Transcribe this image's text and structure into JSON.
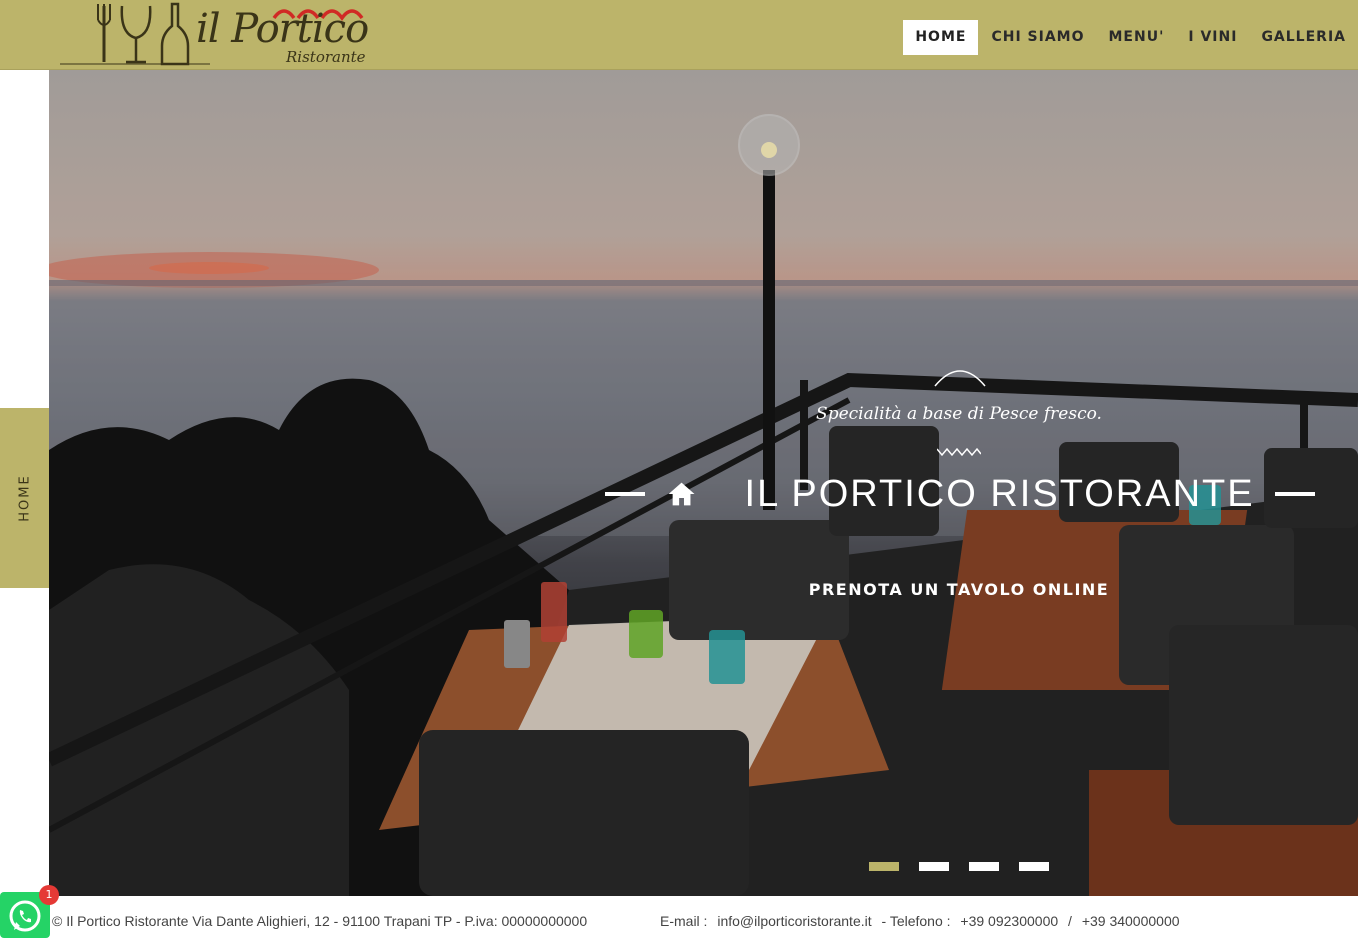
{
  "brand": {
    "logo_name": "il Portico",
    "logo_sub": "Ristorante",
    "accent_color": "#bcb46a"
  },
  "nav": {
    "items": [
      {
        "label": "HOME",
        "active": true
      },
      {
        "label": "CHI SIAMO",
        "active": false
      },
      {
        "label": "MENU'",
        "active": false
      },
      {
        "label": "I VINI",
        "active": false
      },
      {
        "label": "GALLERIA",
        "active": false
      }
    ]
  },
  "side_tab": {
    "label": "HOME"
  },
  "hero": {
    "subtitle": "Specialità a base di Pesce fresco.",
    "title": "IL PORTICO RISTORANTE",
    "cta": "PRENOTA UN TAVOLO ONLINE",
    "slides_total": 4,
    "slide_active": 1,
    "icon": "home-icon"
  },
  "footer": {
    "address": "© Il Portico Ristorante Via Dante Alighieri, 12 - 91100 Trapani TP - P.iva: 00000000000",
    "email_label": "E-mail :",
    "email": "info@ilporticoristorante.it",
    "phone_label": "- Telefono :",
    "phone1": "+39 092300000",
    "separator": "/",
    "phone2": "+39 340000000"
  },
  "whatsapp": {
    "badge": "1",
    "icon": "whatsapp-icon"
  }
}
